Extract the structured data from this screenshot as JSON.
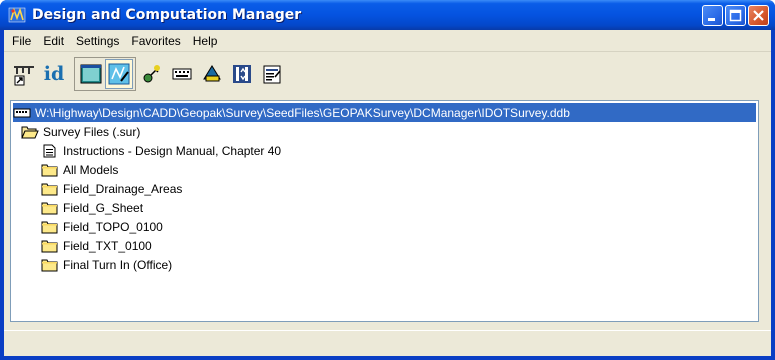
{
  "window": {
    "title": "Design and Computation Manager"
  },
  "menu": {
    "file": "File",
    "edit": "Edit",
    "settings": "Settings",
    "favorites": "Favorites",
    "help": "Help"
  },
  "toolbar": {
    "id_label": "id",
    "buttons": [
      "pointer-icon",
      "id-icon",
      "dialog-icon",
      "draw-icon",
      "key-icon",
      "keyboard-icon",
      "pickup-icon",
      "settings-icon",
      "properties-icon"
    ]
  },
  "tree": {
    "root_path": "W:\\Highway\\Design\\CADD\\Geopak\\Survey\\SeedFiles\\GEOPAKSurvey\\DCManager\\IDOTSurvey.ddb",
    "category": "Survey Files (.sur)",
    "items": [
      {
        "label": "Instructions  - Design Manual, Chapter 40",
        "icon": "document-icon"
      },
      {
        "label": "All Models",
        "icon": "folder-icon"
      },
      {
        "label": "Field_Drainage_Areas",
        "icon": "folder-icon"
      },
      {
        "label": "Field_G_Sheet",
        "icon": "folder-icon"
      },
      {
        "label": "Field_TOPO_0100",
        "icon": "folder-icon"
      },
      {
        "label": "Field_TXT_0100",
        "icon": "folder-icon"
      },
      {
        "label": "Final Turn In (Office)",
        "icon": "folder-icon"
      }
    ]
  },
  "colors": {
    "title_bar": "#0553e0",
    "selection": "#316ac5",
    "client": "#ece9d8"
  }
}
